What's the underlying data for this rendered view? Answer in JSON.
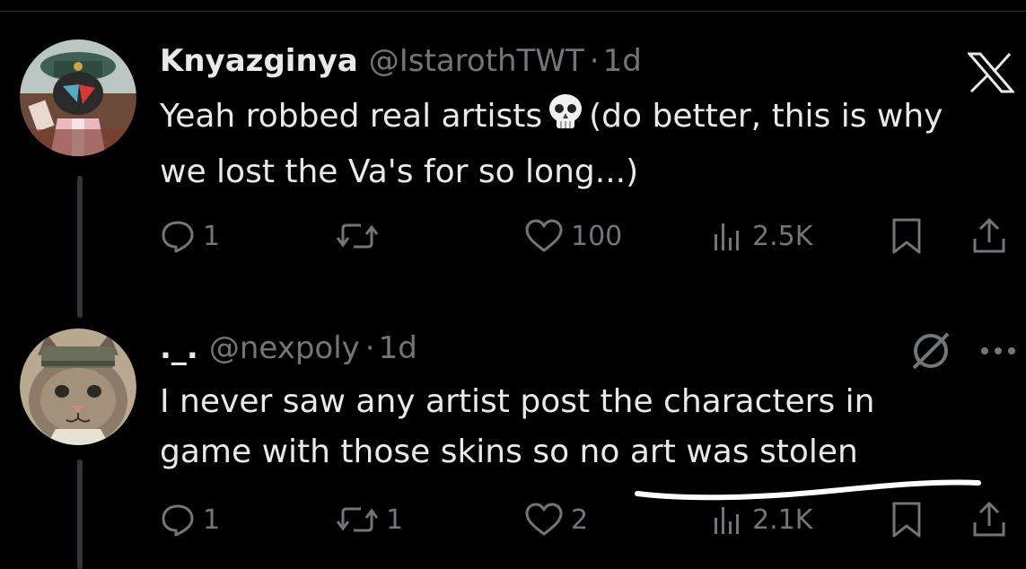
{
  "tweets": [
    {
      "name": "Knyazginya",
      "handle": "@IstarothTWT",
      "sep": "·",
      "time": "1d",
      "text_before": "Yeah robbed real artists",
      "emoji": "skull-emoji",
      "text_after": "(do better, this is why we lost the Va's for so long...)",
      "replies": "1",
      "reposts": "",
      "likes": "100",
      "views": "2.5K"
    },
    {
      "name": "._.",
      "handle": "@nexpoly",
      "sep": "·",
      "time": "1d",
      "text": "I never saw any artist post the characters in game with those skins so no art was stolen",
      "replies": "1",
      "reposts": "1",
      "likes": "2",
      "views": "2.1K"
    }
  ],
  "icons": {
    "platform": "x-logo-icon",
    "mute": "mute-icon",
    "more": "more-icon"
  },
  "colors": {
    "background": "#000000",
    "text": "#e7e9ea",
    "secondary": "#71767b",
    "annotation": "#ffffff"
  }
}
